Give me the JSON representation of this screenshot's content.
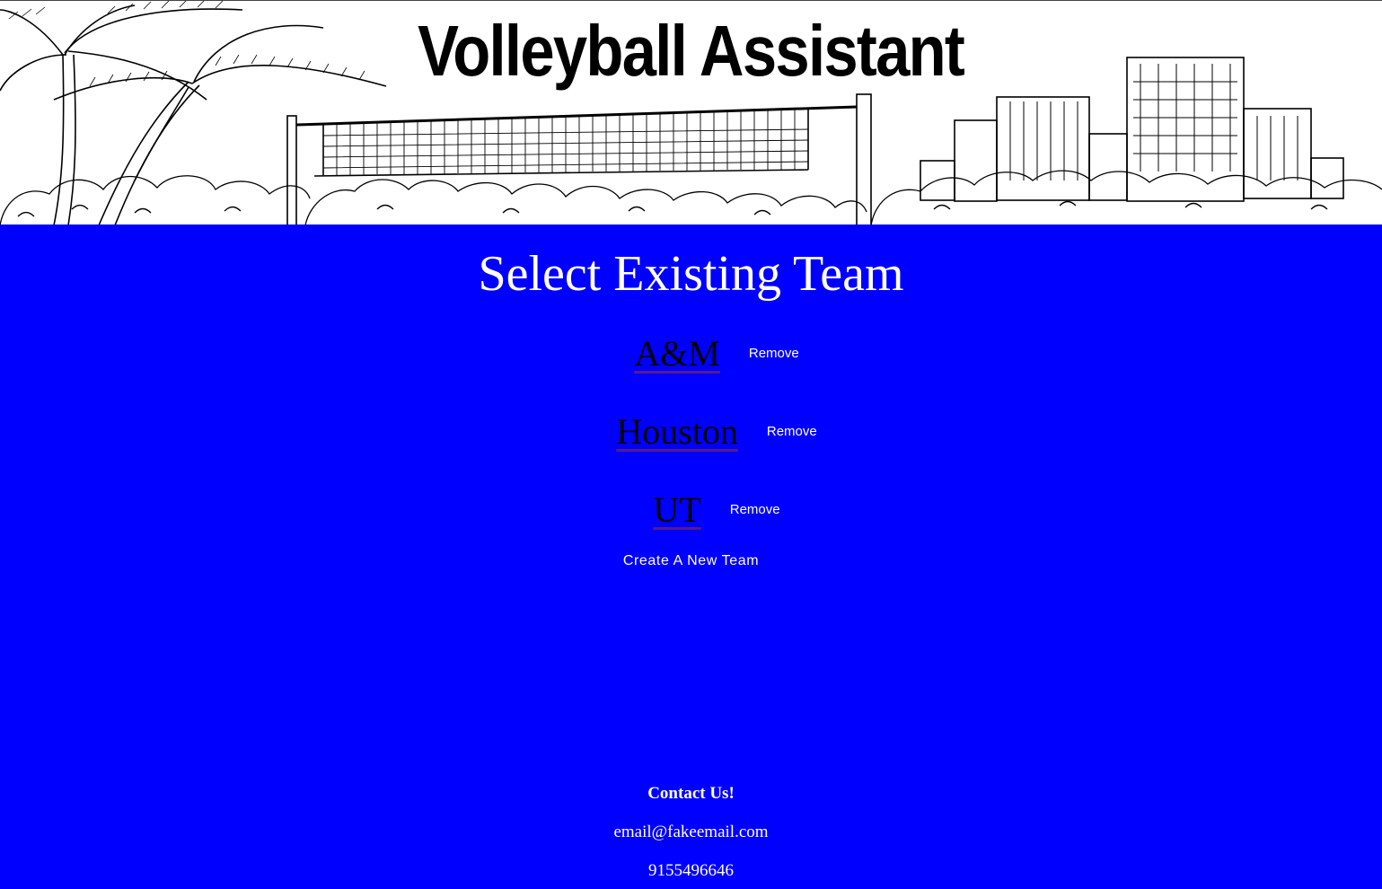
{
  "header": {
    "title": "Volleyball Assistant"
  },
  "main": {
    "heading": "Select Existing Team",
    "teams": [
      {
        "name": "A&M",
        "remove_label": "Remove"
      },
      {
        "name": "Houston",
        "remove_label": "Remove"
      },
      {
        "name": "UT",
        "remove_label": "Remove"
      }
    ],
    "create_label": "Create A New Team"
  },
  "footer": {
    "heading": "Contact Us!",
    "email": "email@fakeemail.com",
    "phone": "9155496646"
  },
  "colors": {
    "background": "#0000ff",
    "banner": "#ffffff",
    "text": "#ffffff",
    "link": "#000000",
    "link_underline": "#551a8b"
  }
}
